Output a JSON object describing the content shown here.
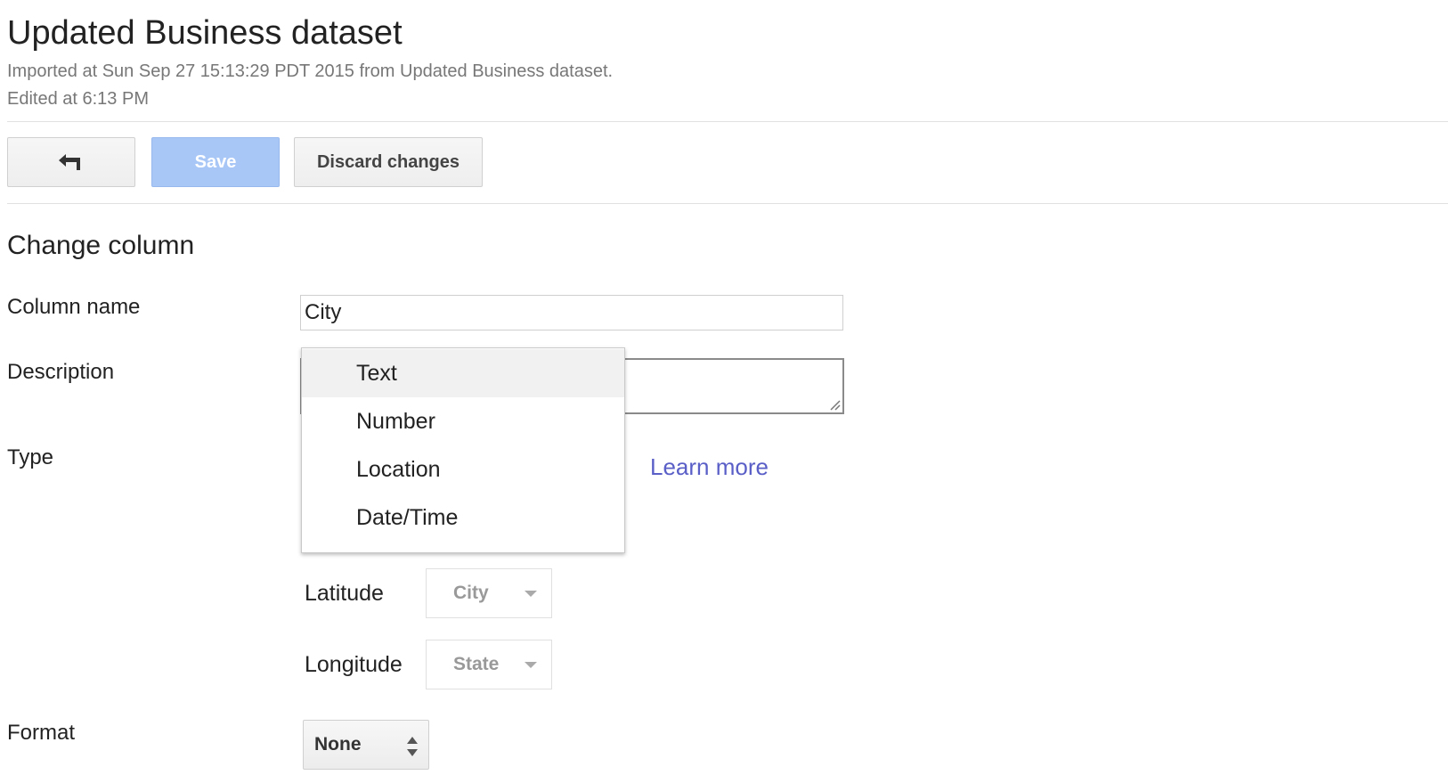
{
  "header": {
    "title": "Updated Business dataset",
    "imported_text": "Imported at Sun Sep 27 15:13:29 PDT 2015 from Updated Business dataset.",
    "edited_text": "Edited at 6:13 PM"
  },
  "toolbar": {
    "back_icon": "back-arrow-icon",
    "save_label": "Save",
    "discard_label": "Discard changes"
  },
  "form": {
    "section_title": "Change column",
    "column_name_label": "Column name",
    "column_name_value": "City",
    "description_label": "Description",
    "description_value": "",
    "type_label": "Type",
    "learn_more": "Learn more",
    "type_menu": {
      "items": [
        "Text",
        "Number",
        "Location",
        "Date/Time"
      ],
      "highlighted": "Text"
    },
    "latitude_label": "Latitude",
    "latitude_value": "City",
    "longitude_label": "Longitude",
    "longitude_value": "State",
    "format_label": "Format",
    "format_value": "None"
  },
  "colors": {
    "save_bg": "#a8c7f7",
    "link": "#5a5fc7",
    "muted_text": "#777777"
  }
}
